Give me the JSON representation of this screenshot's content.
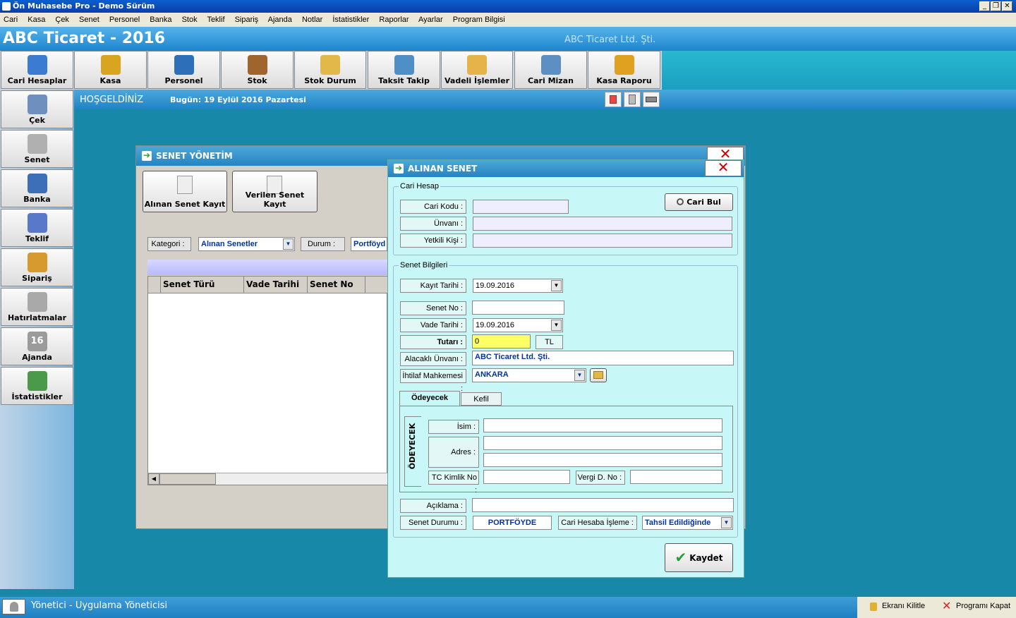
{
  "window": {
    "title": "Ön Muhasebe Pro - Demo Sürüm",
    "minimize": "_",
    "restore": "❐",
    "close": "✕"
  },
  "menu": [
    "Cari",
    "Kasa",
    "Çek",
    "Senet",
    "Personel",
    "Banka",
    "Stok",
    "Teklif",
    "Sipariş",
    "Ajanda",
    "Notlar",
    "İstatistikler",
    "Raporlar",
    "Ayarlar",
    "Program Bilgisi"
  ],
  "header": {
    "app_name": "ABC Ticaret - 2016",
    "company": "ABC Ticaret Ltd. Şti."
  },
  "toolbar": [
    {
      "label": "Cari Hesaplar",
      "icon": "users-icon",
      "color": "#3b7bd1"
    },
    {
      "label": "Kasa",
      "icon": "coins-icon",
      "color": "#d9a520"
    },
    {
      "label": "Personel",
      "icon": "person-icon",
      "color": "#2d6fb8"
    },
    {
      "label": "Stok",
      "icon": "box-icon",
      "color": "#a0652c"
    },
    {
      "label": "Stok Durum",
      "icon": "folder-icon",
      "color": "#e2b84a"
    },
    {
      "label": "Taksit Takip",
      "icon": "card-icon",
      "color": "#4f8fc7"
    },
    {
      "label": "Vadeli İşlemler",
      "icon": "binder-icon",
      "color": "#e6b34a"
    },
    {
      "label": "Cari Mizan",
      "icon": "chart-icon",
      "color": "#5c8fc4"
    },
    {
      "label": "Kasa Raporu",
      "icon": "moneybag-icon",
      "color": "#e0a020"
    }
  ],
  "sidebar": [
    {
      "label": "Çek",
      "icon": "check-icon",
      "color": "#6f8fbf"
    },
    {
      "label": "Senet",
      "icon": "document-icon",
      "color": "#b0b0b0"
    },
    {
      "label": "Banka",
      "icon": "pie-icon",
      "color": "#3c6fb8"
    },
    {
      "label": "Teklif",
      "icon": "notepad-icon",
      "color": "#5a78c9"
    },
    {
      "label": "Sipariş",
      "icon": "order-icon",
      "color": "#d79a2e"
    },
    {
      "label": "Hatırlatmalar",
      "icon": "clock-icon",
      "color": "#a9a9a9"
    },
    {
      "label": "Ajanda",
      "icon": "calendar-icon",
      "color": "#9b9b9b",
      "number": "16"
    },
    {
      "label": "İstatistikler",
      "icon": "stats-icon",
      "color": "#4b9a4b"
    }
  ],
  "welcome": {
    "title": "HOŞGELDİNİZ",
    "today": "Bugün: 19 Eylül 2016 Pazartesi"
  },
  "senet_yonetim": {
    "title": "SENET YÖNETİM",
    "alinan_btn": "Alınan Senet Kayıt",
    "verilen_btn": "Verilen Senet Kayıt",
    "kategori_label": "Kategori :",
    "kategori_value": "Alınan Senetler",
    "durum_label": "Durum :",
    "durum_value": "Portföyd",
    "columns": [
      "Senet Türü",
      "Vade Tarihi",
      "Senet No"
    ]
  },
  "alinan_senet": {
    "title": "ALINAN SENET",
    "cari_hesap": "Cari Hesap",
    "cari_kodu": "Cari Kodu :",
    "unvani": "Ünvanı :",
    "yetkili": "Yetkili Kişi :",
    "cari_bul": "Cari Bul",
    "senet_bilgileri": "Senet Bilgileri",
    "kayit_tarihi_label": "Kayıt Tarihi :",
    "kayit_tarihi": "19.09.2016",
    "senet_no_label": "Senet No :",
    "vade_tarihi_label": "Vade Tarihi :",
    "vade_tarihi": "19.09.2016",
    "tutari_label": "Tutarı :",
    "tutari": "0",
    "currency": "TL",
    "alacakli_label": "Alacaklı Ünvanı :",
    "alacakli": "ABC Ticaret Ltd. Şti.",
    "ihtilaf_label": "İhtilaf Mahkemesi :",
    "ihtilaf": "ANKARA",
    "tabs": [
      "Ödeyecek",
      "Kefil"
    ],
    "vertical_title": "ÖDEYECEK",
    "isim_label": "İsim :",
    "adres_label": "Adres :",
    "tc_label": "TC Kimlik No :",
    "vergi_label": "Vergi D. No :",
    "aciklama_label": "Açıklama :",
    "senet_durumu_label": "Senet Durumu :",
    "senet_durumu": "PORTFÖYDE",
    "cari_hesaba_label": "Cari Hesaba İşleme :",
    "cari_hesaba": "Tahsil Edildiğinde",
    "kaydet": "Kaydet"
  },
  "status": {
    "user": "Yönetici - Uygulama Yöneticisi",
    "lock": "Ekranı Kilitle",
    "exit": "Programı Kapat"
  }
}
